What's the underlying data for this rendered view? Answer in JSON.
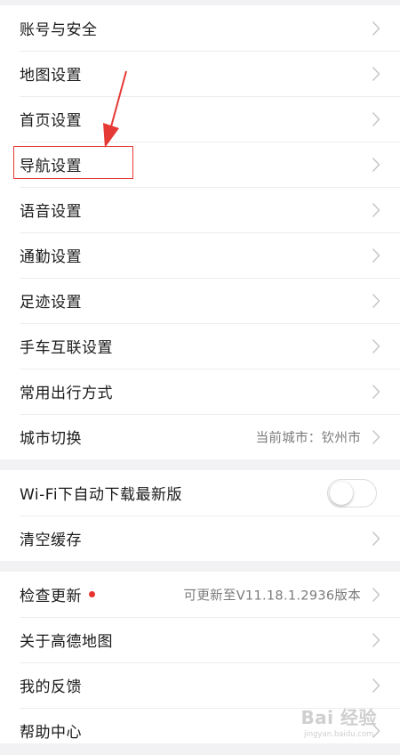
{
  "group1": {
    "items": [
      {
        "label": "账号与安全"
      },
      {
        "label": "地图设置"
      },
      {
        "label": "首页设置"
      },
      {
        "label": "导航设置"
      },
      {
        "label": "语音设置"
      },
      {
        "label": "通勤设置"
      },
      {
        "label": "足迹设置"
      },
      {
        "label": "手车互联设置"
      },
      {
        "label": "常用出行方式"
      },
      {
        "label": "城市切换",
        "value": "当前城市：钦州市"
      }
    ]
  },
  "group2": {
    "wifi_label": "Wi-Fi下自动下载最新版",
    "wifi_toggle_on": false,
    "clear_cache_label": "清空缓存"
  },
  "group3": {
    "items": [
      {
        "label": "检查更新",
        "value": "可更新至V11.18.1.2936版本",
        "has_badge": true
      },
      {
        "label": "关于高德地图"
      },
      {
        "label": "我的反馈"
      },
      {
        "label": "帮助中心"
      }
    ]
  },
  "annotation": {
    "highlight_color": "#e53935"
  },
  "watermark": {
    "main": "Bai 经验",
    "sub": "jingyan.baidu.com"
  },
  "colors": {
    "background": "#f2f2f4",
    "text": "#1a1a1a",
    "secondary": "#7a7a7a",
    "badge": "#e8332f"
  }
}
